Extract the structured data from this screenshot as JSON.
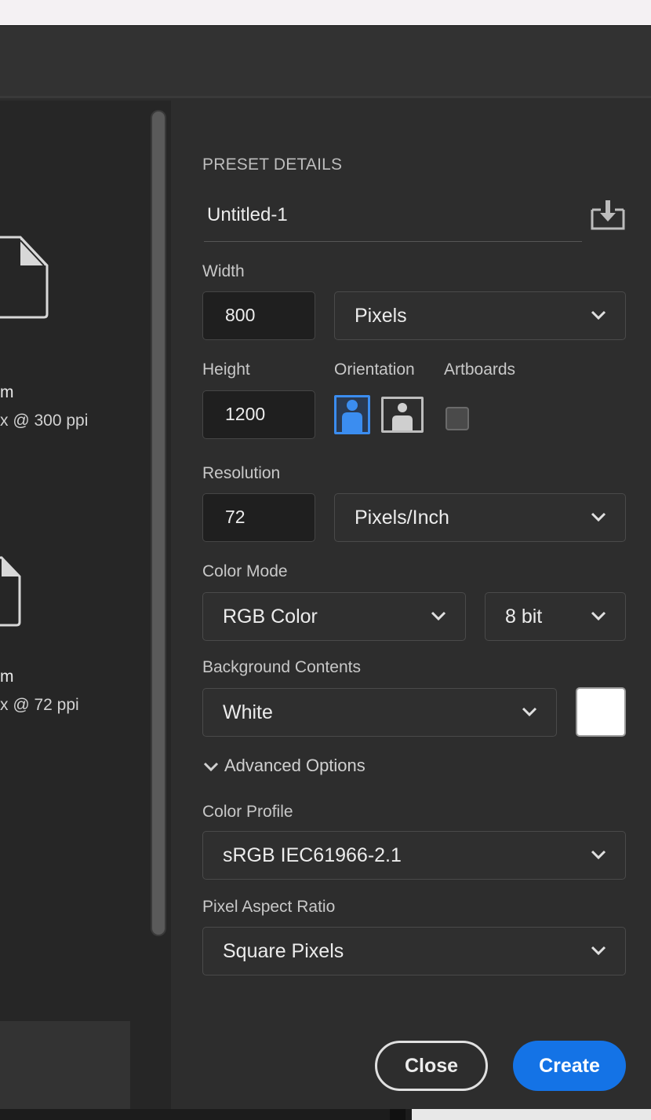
{
  "left_panel": {
    "presets": [
      {
        "name_fragment": "m",
        "detail_fragment": "x @ 300 ppi"
      },
      {
        "name_fragment": "m",
        "detail_fragment": "x @ 72 ppi"
      }
    ]
  },
  "preset_details": {
    "section_title": "PRESET DETAILS",
    "document_name": "Untitled-1",
    "save_preset_icon": "save-preset-icon",
    "width": {
      "label": "Width",
      "value": "800",
      "unit": "Pixels"
    },
    "height": {
      "label": "Height",
      "value": "1200"
    },
    "orientation": {
      "label": "Orientation",
      "selected": "portrait"
    },
    "artboards": {
      "label": "Artboards",
      "checked": false
    },
    "resolution": {
      "label": "Resolution",
      "value": "72",
      "unit": "Pixels/Inch"
    },
    "color_mode": {
      "label": "Color Mode",
      "mode": "RGB Color",
      "bit_depth": "8 bit"
    },
    "background": {
      "label": "Background Contents",
      "value": "White",
      "swatch_color": "#ffffff"
    },
    "advanced": {
      "toggle_label": "Advanced Options",
      "color_profile": {
        "label": "Color Profile",
        "value": "sRGB IEC61966-2.1"
      },
      "pixel_aspect": {
        "label": "Pixel Aspect Ratio",
        "value": "Square Pixels"
      }
    }
  },
  "buttons": {
    "close": "Close",
    "create": "Create"
  },
  "colors": {
    "accent": "#1473e6",
    "panel": "#2d2d2d",
    "field": "#1f1f1f"
  }
}
